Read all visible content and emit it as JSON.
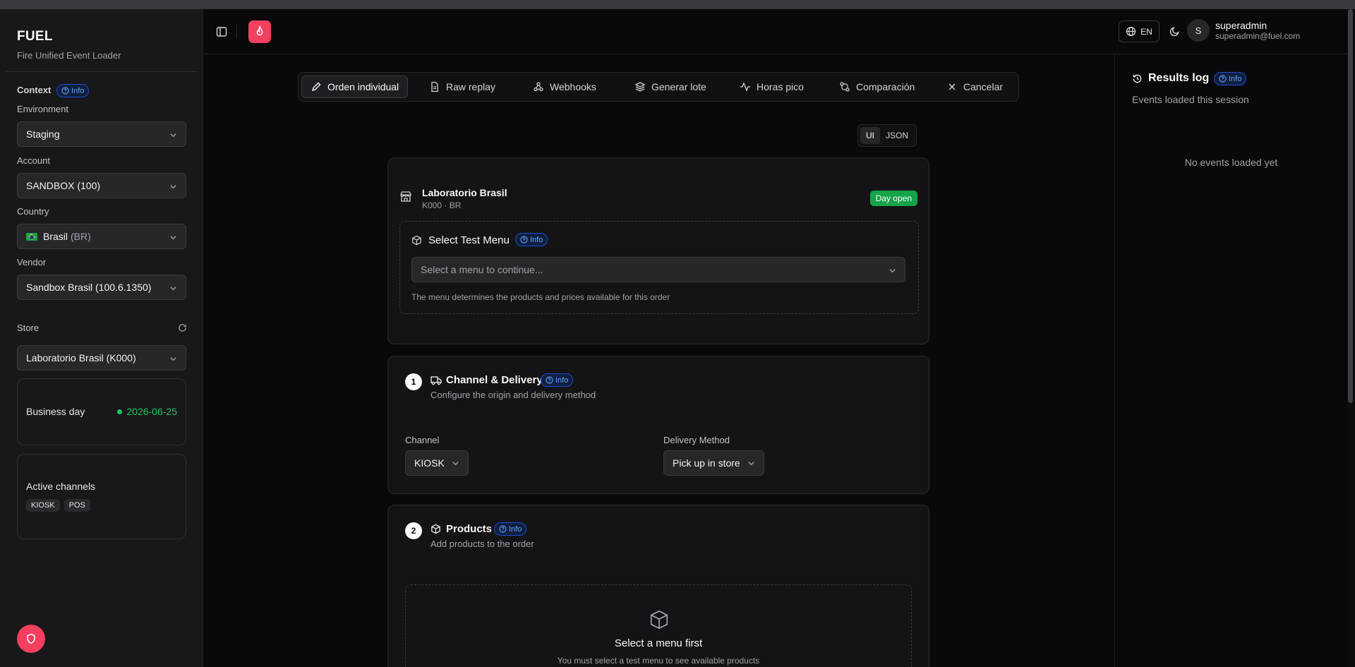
{
  "app": {
    "name": "FUEL",
    "subtitle": "Fire Unified Event Loader"
  },
  "sidebar": {
    "context_label": "Context",
    "info_label": "Info",
    "environment": {
      "label": "Environment",
      "value": "Staging"
    },
    "account": {
      "label": "Account",
      "value": "SANDBOX (100)"
    },
    "country": {
      "label": "Country",
      "value": "Brasil",
      "code": "(BR)"
    },
    "vendor": {
      "label": "Vendor",
      "value": "Sandbox Brasil (100.6.1350)"
    },
    "store": {
      "label": "Store",
      "value": "Laboratorio Brasil (K000)"
    },
    "business_day": {
      "label": "Business day",
      "value": "2026-06-25"
    },
    "active_channels": {
      "label": "Active channels",
      "items": [
        "KIOSK",
        "POS"
      ]
    }
  },
  "header": {
    "language": "EN",
    "user": {
      "initial": "S",
      "name": "superadmin",
      "email": "superadmin@fuel.com"
    }
  },
  "tabs": [
    {
      "label": "Orden individual",
      "icon": "pencil-icon",
      "active": true
    },
    {
      "label": "Raw replay",
      "icon": "file-icon"
    },
    {
      "label": "Webhooks",
      "icon": "webhook-icon"
    },
    {
      "label": "Generar lote",
      "icon": "layers-icon"
    },
    {
      "label": "Horas pico",
      "icon": "activity-icon"
    },
    {
      "label": "Comparación",
      "icon": "compare-icon"
    },
    {
      "label": "Cancelar",
      "icon": "x-icon"
    }
  ],
  "view_toggle": {
    "ui": "UI",
    "json": "JSON",
    "selected": "UI"
  },
  "store_card": {
    "name": "Laboratorio Brasil",
    "code": "K000 · BR",
    "status": "Day open",
    "menu_title": "Select Test Menu",
    "info_label": "Info",
    "menu_placeholder": "Select a menu to continue...",
    "menu_help": "The menu determines the products and prices available for this order"
  },
  "channel_section": {
    "step": "1",
    "title": "Channel & Delivery",
    "info_label": "Info",
    "subtitle": "Configure the origin and delivery method",
    "channel_label": "Channel",
    "channel_value": "KIOSK",
    "delivery_label": "Delivery Method",
    "delivery_value": "Pick up in store"
  },
  "products_section": {
    "step": "2",
    "title": "Products",
    "info_label": "Info",
    "subtitle": "Add products to the order",
    "empty_title": "Select a menu first",
    "empty_desc": "You must select a test menu to see available products"
  },
  "results_log": {
    "title": "Results log",
    "info_label": "Info",
    "subtitle": "Events loaded this session",
    "empty": "No events loaded yet"
  },
  "colors": {
    "accent": "#f43f5e",
    "success": "#22c55e",
    "info": "#60a5fa",
    "status_badge": "#16a34a"
  }
}
